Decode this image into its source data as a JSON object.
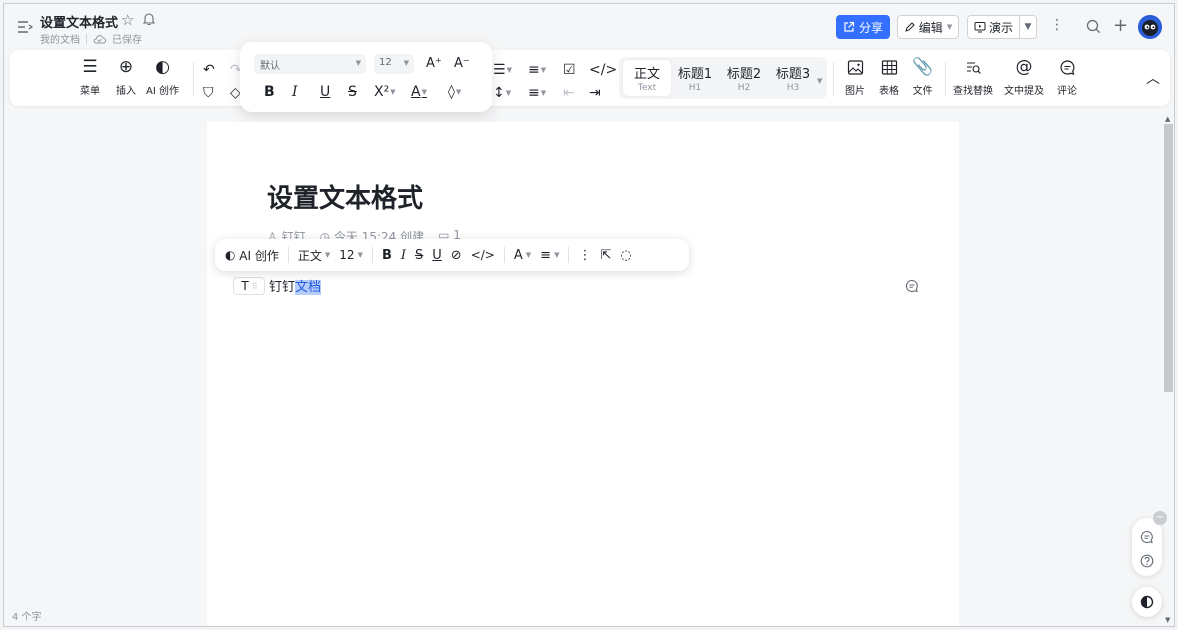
{
  "header": {
    "title": "设置文本格式",
    "breadcrumb": "我的文档",
    "save_status": "已保存",
    "share_label": "分享",
    "edit_label": "编辑",
    "present_label": "演示"
  },
  "toolbar": {
    "menu_label": "菜单",
    "insert_label": "插入",
    "ai_label": "AI 创作",
    "styles": [
      {
        "main": "正文",
        "sub": "Text"
      },
      {
        "main": "标题1",
        "sub": "H1"
      },
      {
        "main": "标题2",
        "sub": "H2"
      },
      {
        "main": "标题3",
        "sub": "H3"
      }
    ],
    "image_label": "图片",
    "table_label": "表格",
    "file_label": "文件",
    "find_replace_label": "查找替换",
    "mention_label": "文中提及",
    "comment_label": "评论"
  },
  "format_popup": {
    "font_value": "默认",
    "size_value": "12"
  },
  "document": {
    "title": "设置文本格式",
    "author": "钉钉",
    "created": "今天 15:24 创建",
    "reads": "1",
    "body_plain": "钉钉",
    "body_selected": "文档"
  },
  "bubble_toolbar": {
    "ai_label": "AI 创作",
    "style_value": "正文",
    "size_value": "12"
  },
  "status": {
    "word_count": "4 个字"
  },
  "colors": {
    "accent": "#3370ff",
    "selection": "#b6cdfc"
  }
}
